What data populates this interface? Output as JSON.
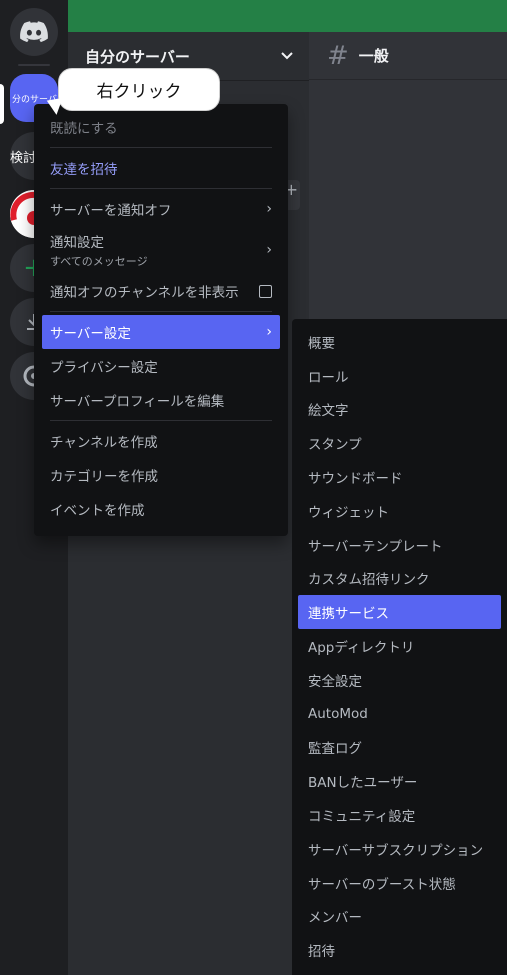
{
  "rail": {
    "server_active_label": "分のサーバ",
    "server2_label": "検討",
    "add_glyph": "+",
    "icons": [
      "discord-logo",
      "download-icon",
      "discover-icon"
    ]
  },
  "sidebar": {
    "server_name": "自分のサーバー"
  },
  "channel": {
    "name": "一般"
  },
  "tooltip": {
    "text": "右クリック"
  },
  "context_menu": {
    "items": [
      {
        "label": "既読にする"
      },
      {
        "label": "友達を招待"
      },
      {
        "label": "サーバーを通知オフ"
      },
      {
        "label": "通知設定",
        "sub": "すべてのメッセージ"
      },
      {
        "label": "通知オフのチャンネルを非表示"
      },
      {
        "label": "サーバー設定"
      },
      {
        "label": "プライバシー設定"
      },
      {
        "label": "サーバープロフィールを編集"
      },
      {
        "label": "チャンネルを作成"
      },
      {
        "label": "カテゴリーを作成"
      },
      {
        "label": "イベントを作成"
      }
    ]
  },
  "settings_menu": {
    "items": [
      "概要",
      "ロール",
      "絵文字",
      "スタンプ",
      "サウンドボード",
      "ウィジェット",
      "サーバーテンプレート",
      "カスタム招待リンク",
      "連携サービス",
      "Appディレクトリ",
      "安全設定",
      "AutoMod",
      "監査ログ",
      "BANしたユーザー",
      "コミュニティ設定",
      "サーバーサブスクリプション",
      "サーバーのブースト状態",
      "メンバー",
      "招待"
    ],
    "highlighted": "連携サービス"
  },
  "colors": {
    "accent": "#5865f2",
    "banner": "#248046",
    "menu_bg": "#111214"
  }
}
